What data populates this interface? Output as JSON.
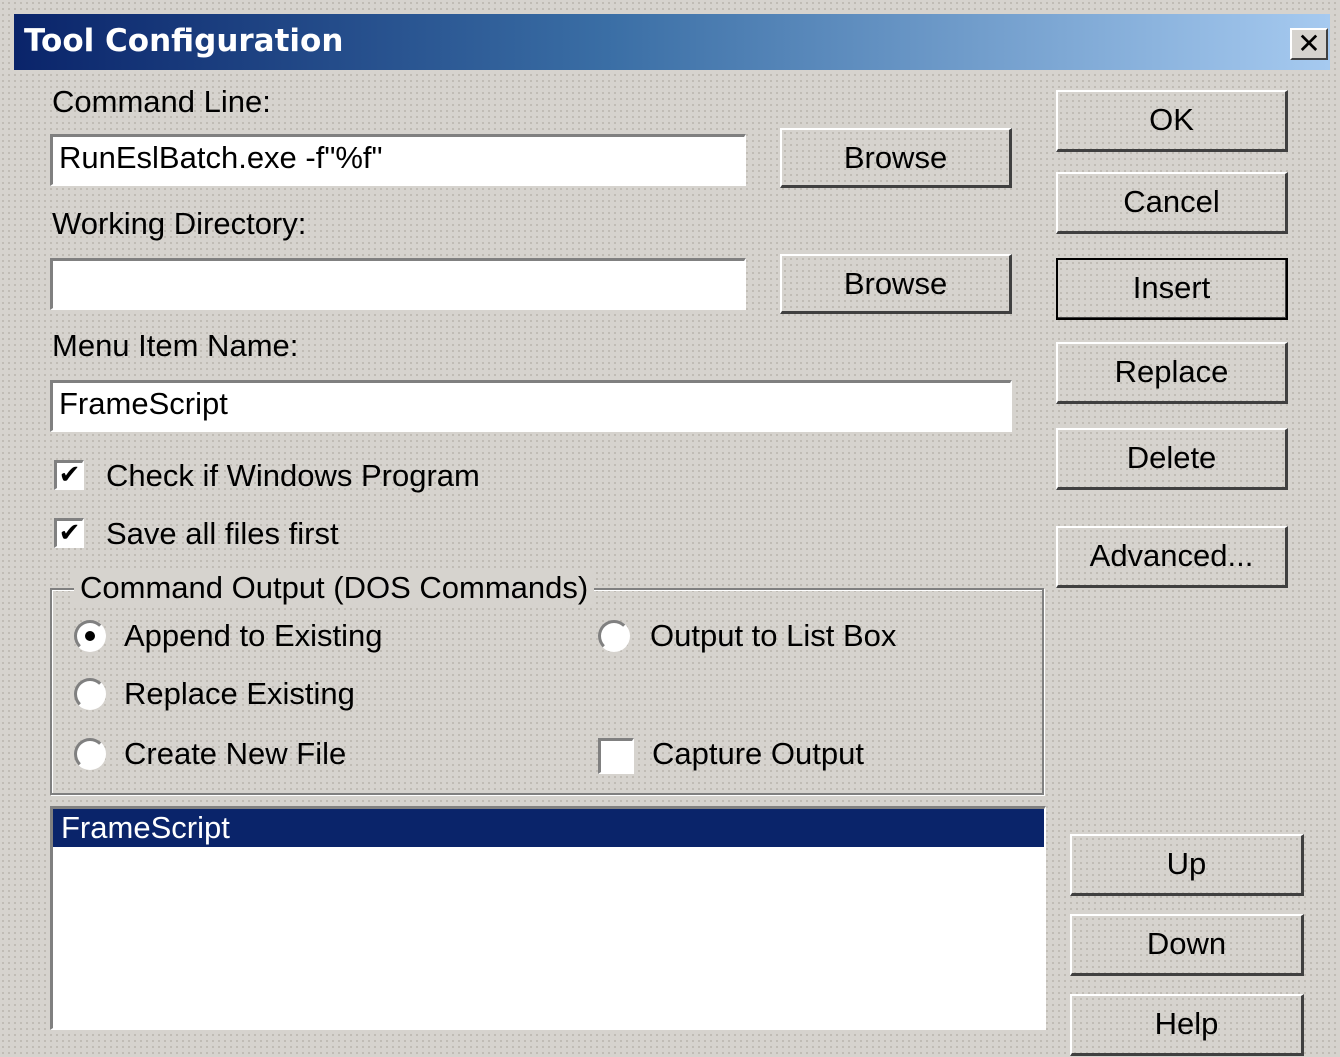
{
  "window": {
    "title": "Tool Configuration",
    "close_label": "✕"
  },
  "command_line": {
    "label": "Command Line:",
    "value": "RunEslBatch.exe -f\"%f\"",
    "browse_label": "Browse"
  },
  "working_directory": {
    "label": "Working Directory:",
    "value": "",
    "browse_label": "Browse"
  },
  "menu_item_name": {
    "label": "Menu Item Name:",
    "value": "FrameScript"
  },
  "options": {
    "windows_program": {
      "label": "Check if Windows Program",
      "checked": true
    },
    "save_all": {
      "label": "Save all files first",
      "checked": true
    }
  },
  "command_output": {
    "legend": "Command Output (DOS Commands)",
    "append": {
      "label": "Append to Existing",
      "selected": true
    },
    "replace": {
      "label": "Replace Existing",
      "selected": false
    },
    "create": {
      "label": "Create New File",
      "selected": false
    },
    "list_box": {
      "label": "Output to List Box",
      "selected": false
    },
    "capture": {
      "label": "Capture Output",
      "checked": false
    }
  },
  "tool_list": {
    "items": [
      "FrameScript"
    ],
    "selected_index": 0
  },
  "buttons": {
    "ok": "OK",
    "cancel": "Cancel",
    "insert": "Insert",
    "replace": "Replace",
    "delete": "Delete",
    "advanced": "Advanced...",
    "up": "Up",
    "down": "Down",
    "help": "Help"
  },
  "colors": {
    "titlebar_start": "#0a246a",
    "titlebar_end": "#a6caf0",
    "face": "#d6d3ce",
    "selection": "#0a246a"
  }
}
